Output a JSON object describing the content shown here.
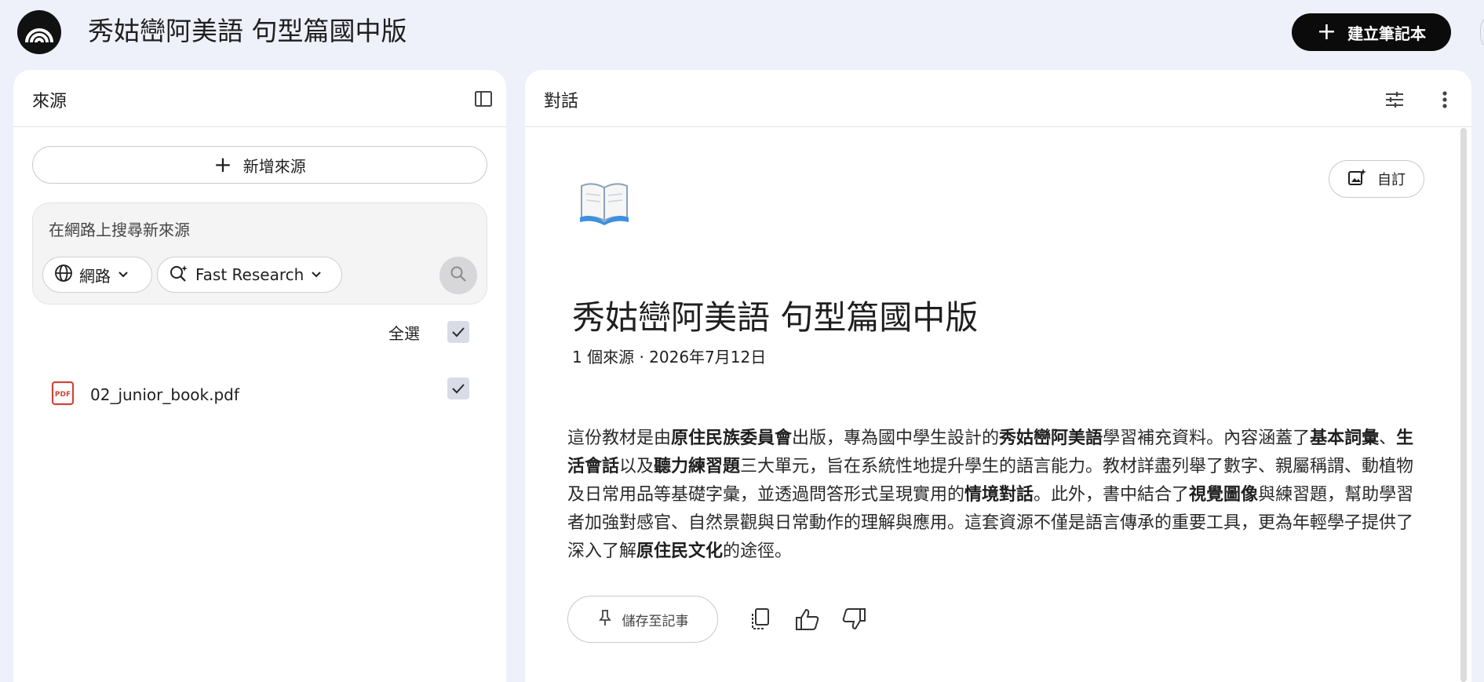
{
  "header": {
    "title": "秀姑巒阿美語 句型篇國中版",
    "logo_icon": "notebook-logo-icon",
    "create_button_label": "建立筆記本"
  },
  "sources_panel": {
    "title": "來源",
    "collapse_icon": "sidebar-toggle-icon",
    "add_source_label": "新增來源",
    "search": {
      "placeholder": "在網路上搜尋新來源",
      "source_type_chip": "網路",
      "mode_chip": "Fast Research"
    },
    "select_all_label": "全選",
    "select_all_checked": true,
    "items": [
      {
        "name": "02_junior_book.pdf",
        "type_icon": "pdf-icon",
        "checked": true
      }
    ]
  },
  "chat_panel": {
    "title": "對話",
    "customize_label": "自訂",
    "notebook": {
      "title": "秀姑巒阿美語 句型篇國中版",
      "meta": "1 個來源 · 2026年7月12日",
      "summary": [
        {
          "text": "這份教材是由",
          "bold": false
        },
        {
          "text": "原住民族委員會",
          "bold": true
        },
        {
          "text": "出版，專為國中學生設計的",
          "bold": false
        },
        {
          "text": "秀姑巒阿美語",
          "bold": true
        },
        {
          "text": "學習補充資料。內容涵蓋了",
          "bold": false
        },
        {
          "text": "基本詞彙",
          "bold": true
        },
        {
          "text": "、",
          "bold": false
        },
        {
          "text": "生活會話",
          "bold": true
        },
        {
          "text": "以及",
          "bold": false
        },
        {
          "text": "聽力練習題",
          "bold": true
        },
        {
          "text": "三大單元，旨在系統性地提升學生的語言能力。教材詳盡列舉了數字、親屬稱謂、動植物及日常用品等基礎字彙，並透過問答形式呈現實用的",
          "bold": false
        },
        {
          "text": "情境對話",
          "bold": true
        },
        {
          "text": "。此外，書中結合了",
          "bold": false
        },
        {
          "text": "視覺圖像",
          "bold": true
        },
        {
          "text": "與練習題，幫助學習者加強對感官、自然景觀與日常動作的理解與應用。這套資源不僅是語言傳承的重要工具，更為年輕學子提供了深入了解",
          "bold": false
        },
        {
          "text": "原住民文化",
          "bold": true
        },
        {
          "text": "的途徑。",
          "bold": false
        }
      ]
    },
    "actions": {
      "save_note_label": "儲存至記事"
    }
  }
}
